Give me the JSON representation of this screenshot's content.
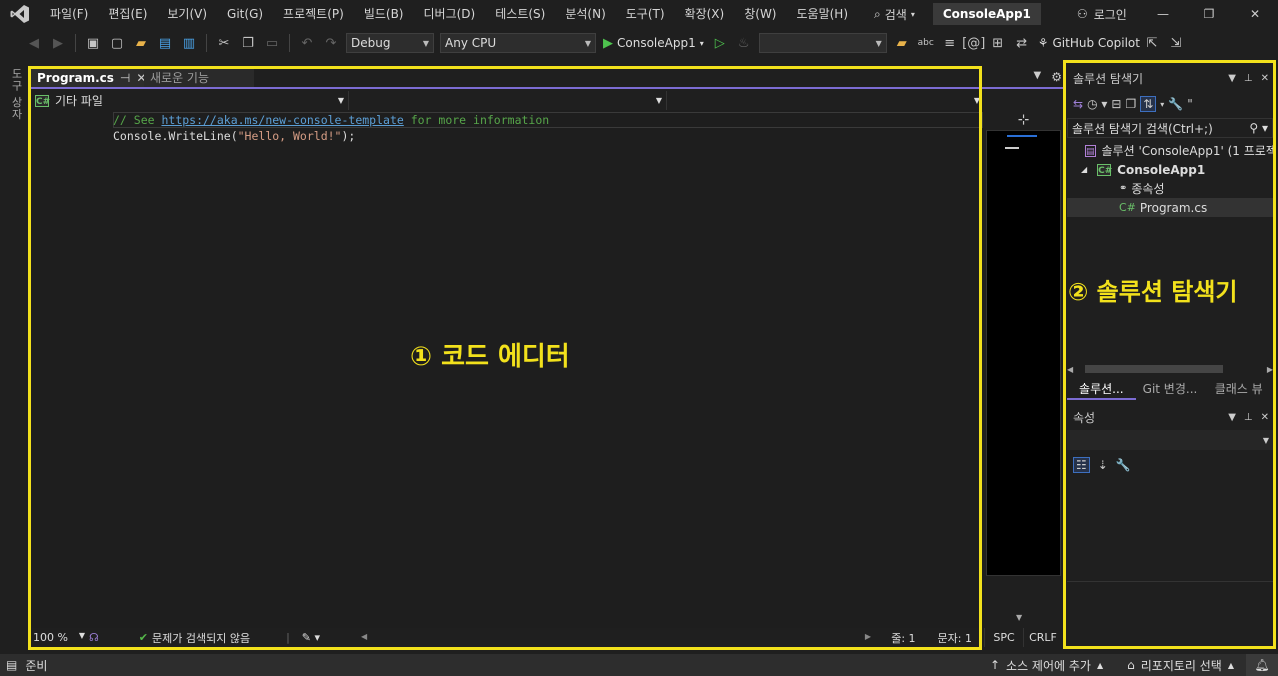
{
  "menu": {
    "items": [
      "파일(F)",
      "편집(E)",
      "보기(V)",
      "Git(G)",
      "프로젝트(P)",
      "빌드(B)",
      "디버그(D)",
      "테스트(S)",
      "분석(N)",
      "도구(T)",
      "확장(X)",
      "창(W)",
      "도움말(H)"
    ],
    "search_label": "검색",
    "solution_name": "ConsoleApp1",
    "login_label": "로그인"
  },
  "toolbar": {
    "configuration": "Debug",
    "platform": "Any CPU",
    "run_target": "ConsoleApp1",
    "copilot_label": "GitHub Copilot"
  },
  "toolbox": {
    "label": "도구 상자"
  },
  "editor": {
    "tabs": [
      {
        "label": "Program.cs",
        "active": true
      },
      {
        "label": "새로운 기능",
        "active": false
      }
    ],
    "nav_file_scope": "기타 파일",
    "code": {
      "line1_comment_prefix": "// See ",
      "line1_link": "https://aka.ms/new-console-template",
      "line1_comment_suffix": " for more information",
      "line2_call": "Console.WriteLine(",
      "line2_string": "\"Hello, World!\"",
      "line2_end": ");"
    },
    "annotation": "① 코드 에디터",
    "zoom": "100 %",
    "issues": "문제가 검색되지 않음",
    "line_label": "줄: 1",
    "col_label": "문자: 1",
    "whitespace": "SPC",
    "line_ending": "CRLF"
  },
  "solution_explorer": {
    "title": "솔루션 탐색기",
    "search_placeholder": "솔루션 탐색기 검색(Ctrl+;)",
    "tree": {
      "solution": "솔루션 'ConsoleApp1' (1 프로젝트",
      "project": "ConsoleApp1",
      "dependencies": "종속성",
      "file": "Program.cs"
    },
    "annotation": "② 솔루션 탐색기",
    "bottom_tabs": [
      "솔루션...",
      "Git 변경...",
      "클래스 뷰"
    ]
  },
  "properties": {
    "title": "속성"
  },
  "statusbar": {
    "ready": "준비",
    "source_control": "소스 제어에 추가",
    "repository": "리포지토리 선택"
  },
  "colors": {
    "highlight_frame": "#f2e11c",
    "accent": "#7c6cd3",
    "comment": "#57a64a",
    "link": "#5c9fd6",
    "string": "#d69d85"
  }
}
